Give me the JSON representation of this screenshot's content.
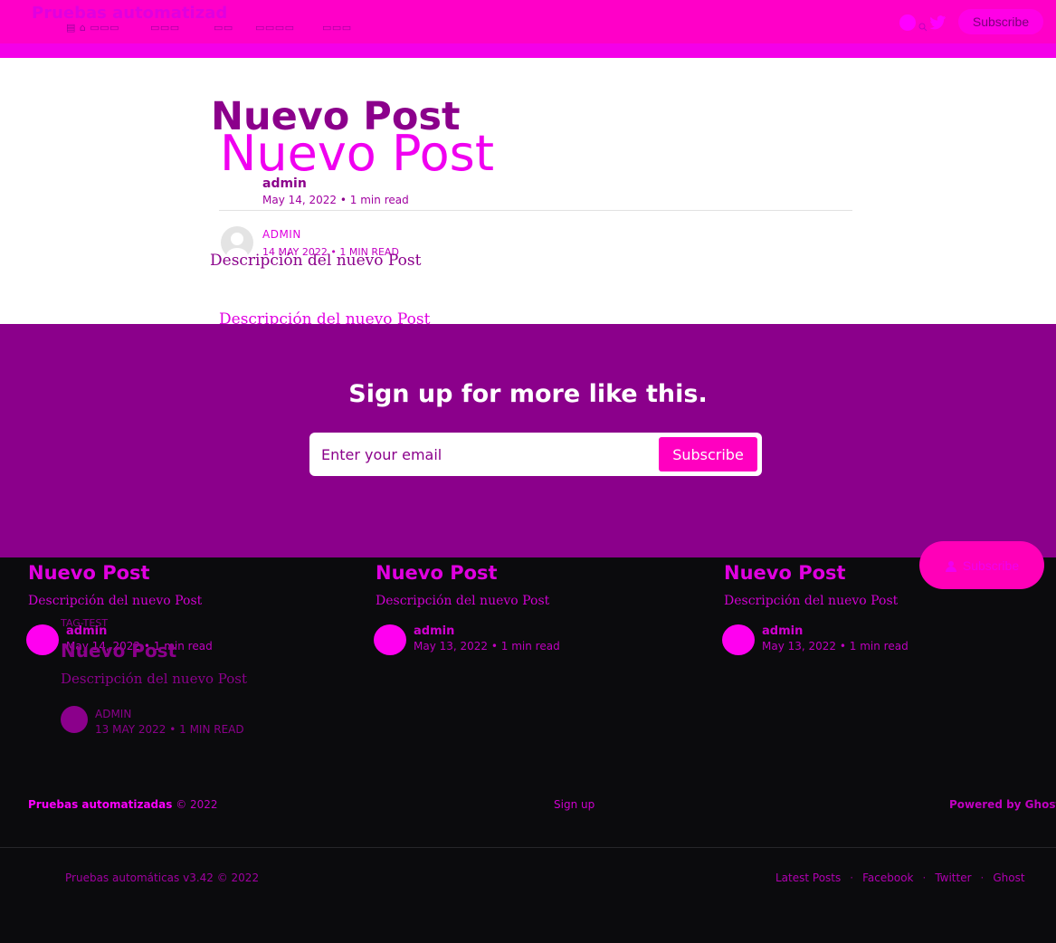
{
  "colors": {
    "header_bg": "#ff00c8",
    "accent": "#8b008b",
    "signup_bg": "#8b008b",
    "button_pink": "#ff00c0",
    "footer_bg": "#0b0b0d"
  },
  "header": {
    "site_title": "Pruebas automatizad",
    "ghost_overlay": "",
    "subscribe": "Subscribe",
    "icons": [
      "facebook-icon",
      "twitter-icon"
    ]
  },
  "article": {
    "title": "Nuevo Post",
    "title_ghost": "Nuevo Post",
    "author": "admin",
    "date": "May 14, 2022",
    "read_time": "1 min read",
    "author_caps": "ADMIN",
    "date_caps": "14 MAY 2022",
    "read_time_caps": "1 MIN READ",
    "excerpt": "Descripción del nuevo Post",
    "excerpt_ghost": "Descripción del nuevo Post"
  },
  "signup": {
    "title": "Sign up for more like this.",
    "placeholder": "Enter your email",
    "button": "Subscribe"
  },
  "cards": [
    {
      "title": "Nuevo Post",
      "excerpt": "Descripción del nuevo Post",
      "author": "admin",
      "date": "May 14, 2022",
      "read_time": "1 min read"
    },
    {
      "title": "Nuevo Post",
      "excerpt": "Descripción del nuevo Post",
      "author": "admin",
      "date": "May 13, 2022",
      "read_time": "1 min read"
    },
    {
      "title": "Nuevo Post",
      "excerpt": "Descripción del nuevo Post",
      "author": "admin",
      "date": "May 13, 2022",
      "read_time": "1 min read"
    }
  ],
  "ghost_card": {
    "tag": "TAG-TEST",
    "title": "Nuevo Post",
    "excerpt": "Descripción del nuevo Post",
    "author": "ADMIN",
    "date": "13 MAY 2022",
    "read_time": "1 MIN READ"
  },
  "portal_button": "Subscribe",
  "footer": {
    "site": "Pruebas automatizadas",
    "copyright": " © 2022",
    "signup": "Sign up",
    "powered": "Powered by Ghost",
    "secondary": "Pruebas automáticas v3.42 © 2022",
    "links": [
      "Latest Posts",
      "Facebook",
      "Twitter",
      "Ghost"
    ]
  }
}
